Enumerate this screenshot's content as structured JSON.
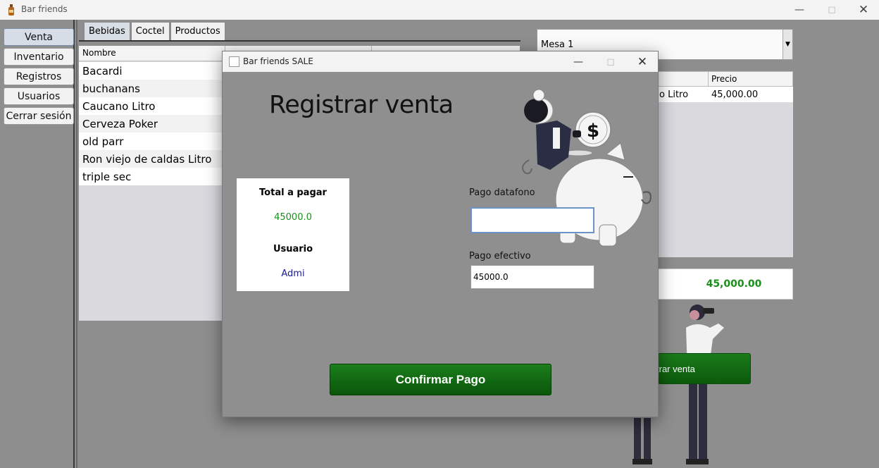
{
  "window": {
    "title": "Bar friends"
  },
  "sidebar": {
    "items": [
      {
        "label": "Venta",
        "active": true
      },
      {
        "label": "Inventario"
      },
      {
        "label": "Registros"
      },
      {
        "label": "Usuarios"
      },
      {
        "label": "Cerrar sesión"
      }
    ]
  },
  "tabs": [
    {
      "label": "Bebidas",
      "active": true
    },
    {
      "label": "Coctel"
    },
    {
      "label": "Productos"
    }
  ],
  "products_table": {
    "columns": [
      "Nombre"
    ],
    "rows": [
      "Bacardi",
      "buchanans",
      "Caucano Litro",
      "Cerveza Poker",
      "old parr",
      "Ron viejo de caldas Litro",
      "triple sec"
    ]
  },
  "mesa_select": {
    "value": "Mesa 1"
  },
  "order_table": {
    "columns": [
      "Precio"
    ],
    "rows": [
      {
        "name": "o Litro",
        "price": "45,000.00"
      }
    ]
  },
  "order_total": "45,000.00",
  "registrar_button": "trar venta",
  "dialog": {
    "title": "Bar friends SALE",
    "heading": "Registrar venta",
    "total_label": "Total a pagar",
    "total_value": "45000.0",
    "user_label": "Usuario",
    "user_value": "Admi",
    "datafono_label": "Pago datafono",
    "datafono_value": "",
    "efectivo_label": "Pago efectivo",
    "efectivo_value": "45000.0",
    "confirm_label": "Confirmar Pago",
    "money_symbol": "$"
  },
  "colors": {
    "accent_green": "#0e6a0e",
    "total_green": "#1a8f1a",
    "user_blue": "#1a1a8c"
  }
}
